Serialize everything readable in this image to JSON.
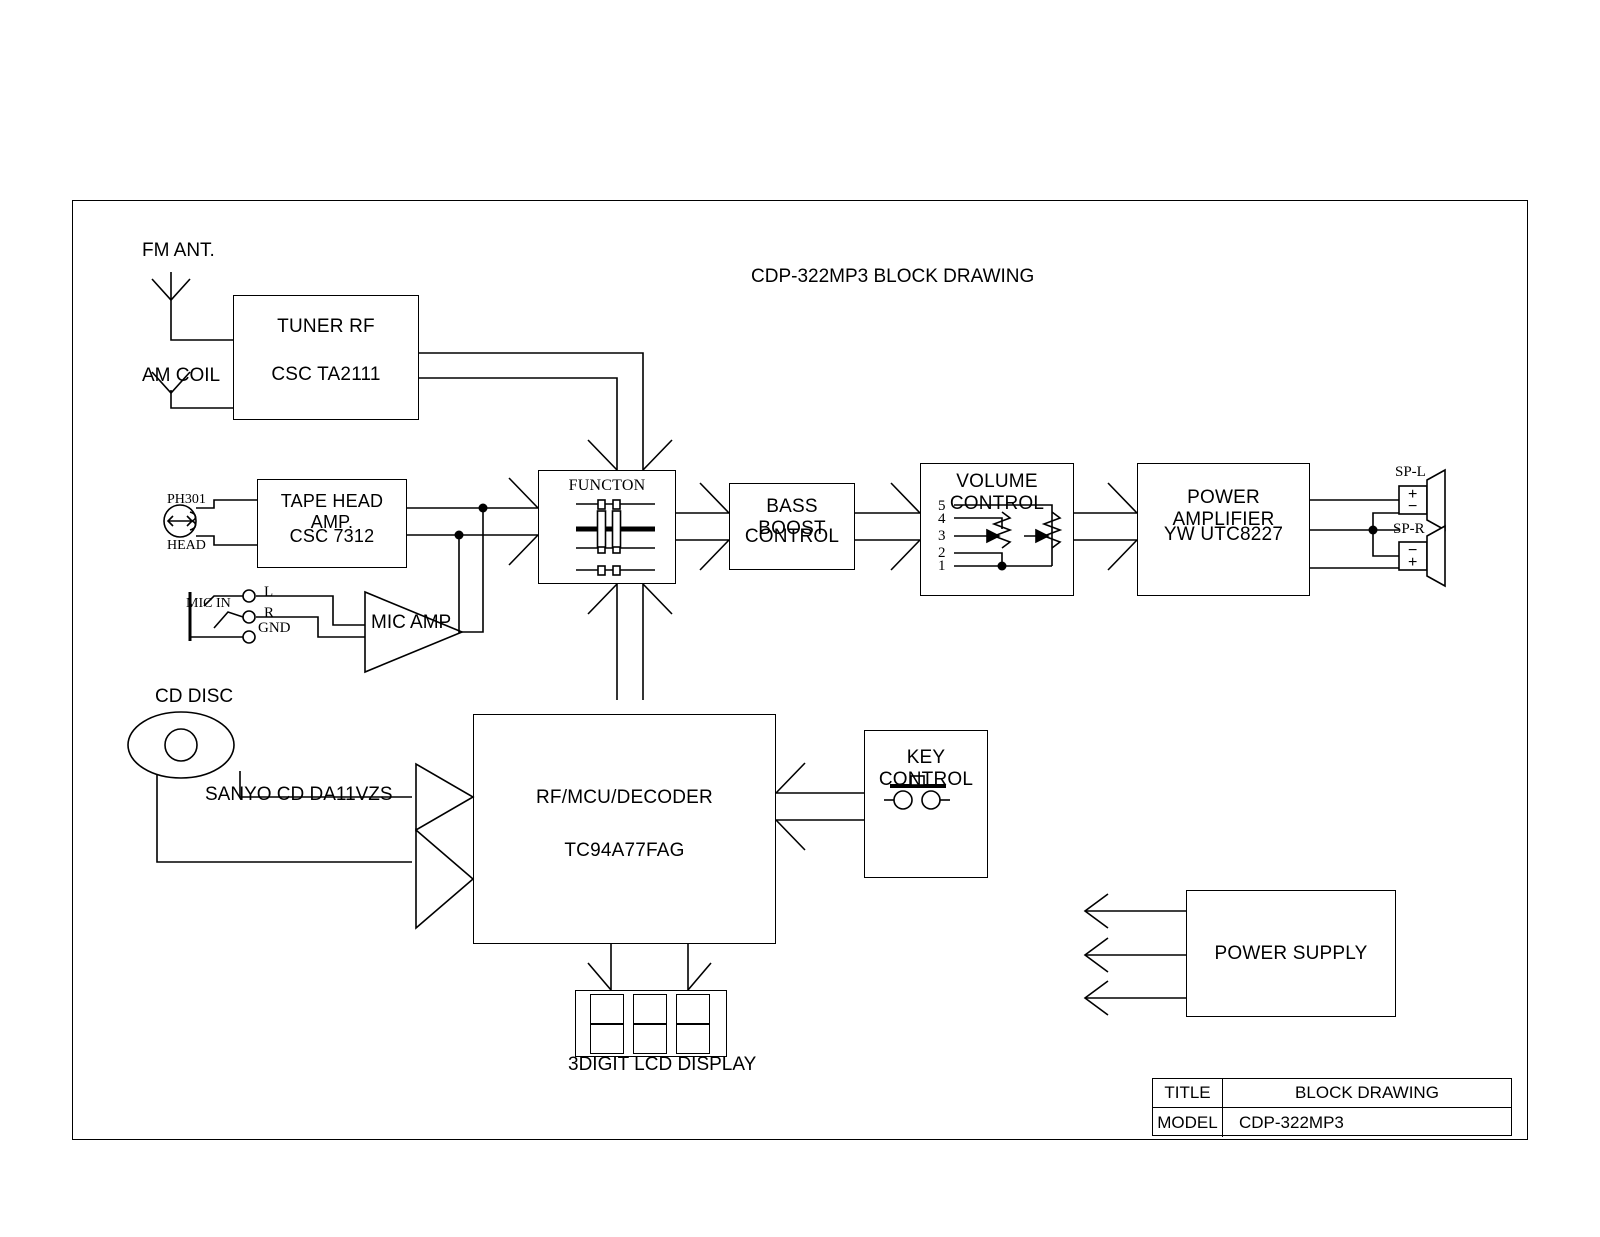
{
  "drawing": {
    "title": "CDP-322MP3 BLOCK DRAWING",
    "sheet_border": true
  },
  "title_block": {
    "title_label": "TITLE",
    "title_value": "BLOCK DRAWING",
    "model_label": "MODEL",
    "model_value": "CDP-322MP3"
  },
  "inputs": {
    "fm_antenna": "FM ANT.",
    "am_coil": "AM COIL",
    "phono_ref": "PH301",
    "head_label": "HEAD",
    "mic_in": "MIC IN",
    "mic_l": "L",
    "mic_r": "R",
    "mic_gnd": "GND",
    "cd_disc": "CD DISC",
    "cd_mech": "SANYO CD DA11VZS"
  },
  "blocks": [
    {
      "id": "tuner",
      "line1": "TUNER RF",
      "line2": "CSC TA2111"
    },
    {
      "id": "tape",
      "line1": "TAPE HEAD AMP.",
      "line2": "CSC 7312"
    },
    {
      "id": "micamp",
      "line1": "MIC AMP",
      "line2": ""
    },
    {
      "id": "function",
      "line1": "FUNCTON",
      "line2": ""
    },
    {
      "id": "bass",
      "line1": "BASS BOOST",
      "line2": "CONTROL"
    },
    {
      "id": "volume",
      "line1": "VOLUME CONTROL",
      "line2": ""
    },
    {
      "id": "poweramp",
      "line1": "POWER AMPLIFIER",
      "line2": "YW UTC8227"
    },
    {
      "id": "decoder",
      "line1": "RF/MCU/DECODER",
      "line2": "TC94A77FAG"
    },
    {
      "id": "keyctrl",
      "line1": "KEY CONTROL",
      "line2": ""
    },
    {
      "id": "psu",
      "line1": "POWER SUPPLY",
      "line2": ""
    },
    {
      "id": "lcd",
      "line1": "3DIGIT LCD DISPLAY",
      "line2": ""
    }
  ],
  "volume_pins": {
    "p5": "5",
    "p4": "4",
    "p3": "3",
    "p2": "2",
    "p1": "1"
  },
  "outputs": {
    "speaker_left": "SP-L",
    "speaker_right": "SP-R",
    "spl_plus": "+",
    "spl_minus": "−",
    "spr_minus": "−",
    "spr_plus": "+"
  },
  "colors": {
    "ink": "#000000",
    "paper": "#ffffff"
  }
}
